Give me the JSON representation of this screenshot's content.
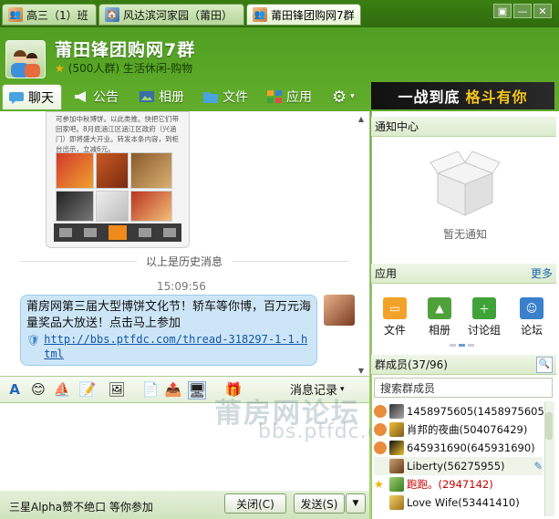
{
  "tabs": [
    {
      "label": "高三（1）班",
      "active": false
    },
    {
      "label": "风达滨河家园（莆田）",
      "active": false
    },
    {
      "label": "莆田锋团购网7群",
      "active": true
    }
  ],
  "window_controls": [
    "▣",
    "—",
    "✕"
  ],
  "header": {
    "title": "莆田锋团购网7群",
    "subtitle": "(500人群) 生活休闲-购物"
  },
  "nav": {
    "items": [
      "聊天",
      "公告",
      "相册",
      "文件",
      "应用"
    ],
    "active": "聊天"
  },
  "banner": {
    "text_a": "一战到底",
    "text_b": "格斗有你"
  },
  "chat": {
    "preview_text": "可参加中秋博饼。以此类推。快把它们带回家吧。8月底涵江区涵江区政府（兴涵门）即将盛大开业。转发本条内容，到柜台出示，立减6元。",
    "history_label": "以上是历史消息",
    "time": "15:09:56",
    "message_text": "莆房网第三届大型博饼文化节！轿车等你博，百万元海量奖品大放送！点击马上参加",
    "message_link": "http://bbs.ptfdc.com/thread-318297-1-1.html"
  },
  "input_toolbar": {
    "history_label": "消息记录"
  },
  "bottom": {
    "status": "三星Alpha赞不绝口 等你参加",
    "close_label": "关闭(C)",
    "send_label": "发送(S)"
  },
  "right_panel": {
    "notice_title": "通知中心",
    "notice_empty": "暂无通知",
    "apps_title": "应用",
    "apps_more": "更多",
    "apps": [
      {
        "label": "文件",
        "color": "#f2a22a"
      },
      {
        "label": "相册",
        "color": "#4fa23a"
      },
      {
        "label": "讨论组",
        "color": "#3fa33a"
      },
      {
        "label": "论坛",
        "color": "#3a80cc"
      }
    ],
    "members_title": "群成员(37/96)",
    "search_placeholder": "搜索群成员",
    "members": [
      {
        "name": "1458975605(1458975605)"
      },
      {
        "name": "肖邦的夜曲(504076429)"
      },
      {
        "name": "645931690(645931690)"
      },
      {
        "name": "Liberty(56275955)"
      },
      {
        "name": "跑跑。(2947142)",
        "red": true
      },
      {
        "name": "Love Wife(53441410)"
      }
    ]
  },
  "watermark": {
    "line1": "莆房网论坛",
    "line2": "bbs.ptfdc.com"
  },
  "colors": {
    "theme_green": "#6cb531",
    "bubble": "#cde6f7",
    "link": "#1155aa"
  }
}
